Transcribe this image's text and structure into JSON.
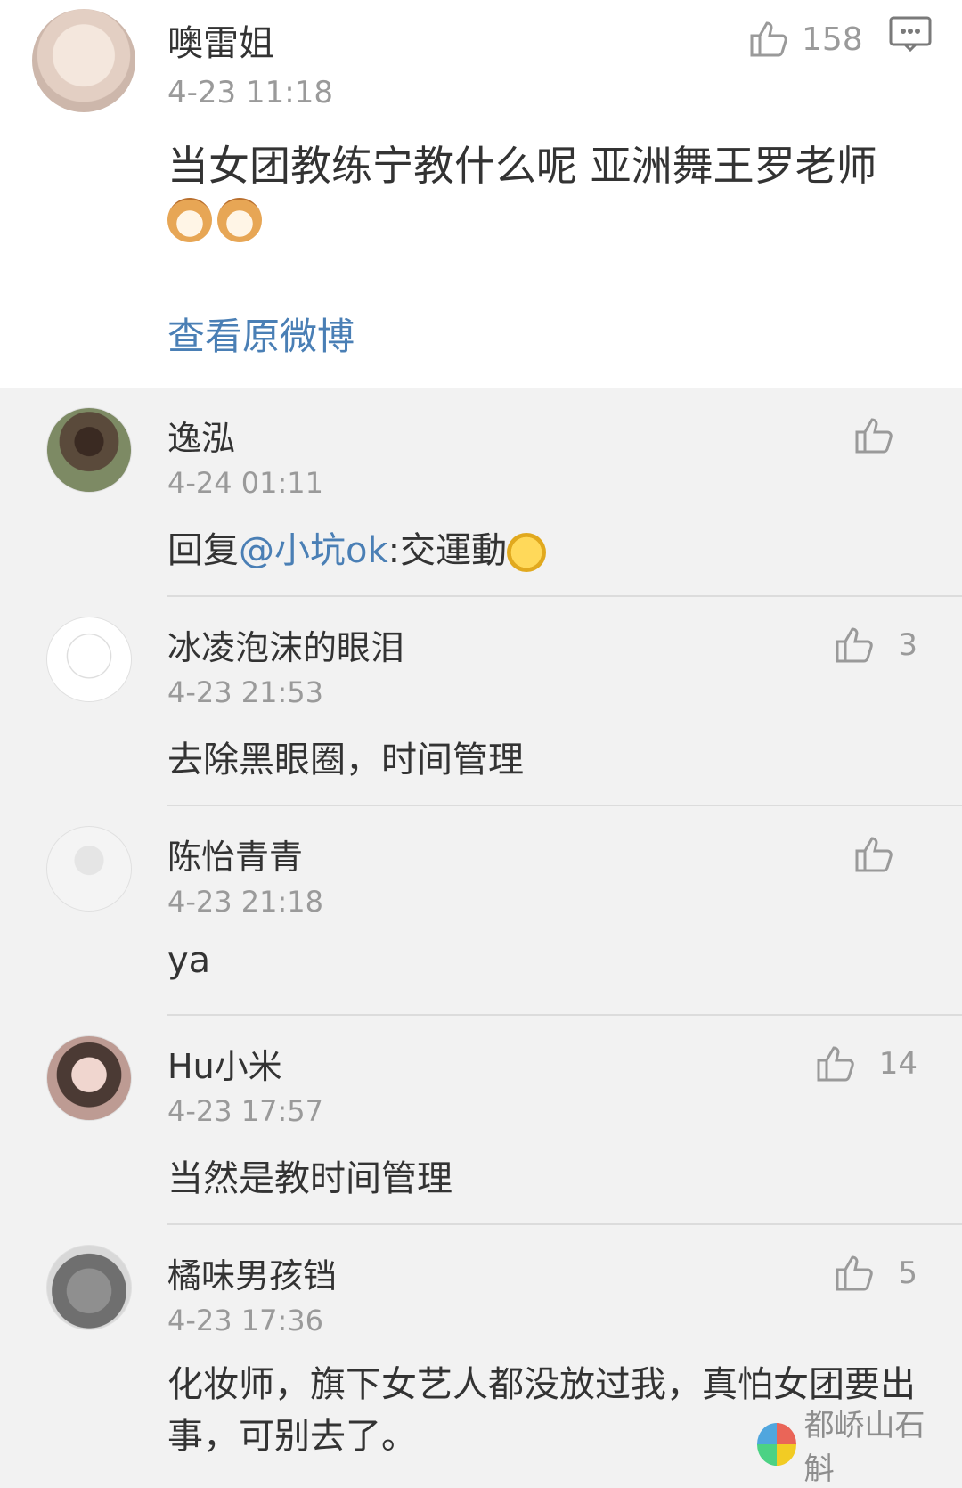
{
  "main": {
    "author": "噢雷姐",
    "time": "4-23 11:18",
    "likes": "158",
    "text": "当女团教练宁教什么呢 亚洲舞王罗老师",
    "view_original": "查看原微博"
  },
  "comments": [
    {
      "name": "逸泓",
      "time": "4-24 01:11",
      "likes": "",
      "reply_prefix": "回复",
      "mention": "@小坑ok",
      "reply_text": ":交運動"
    },
    {
      "name": "冰凌泡沫的眼泪",
      "time": "4-23 21:53",
      "likes": "3",
      "text": "去除黑眼圈，时间管理"
    },
    {
      "name": "陈怡青青",
      "time": "4-23 21:18",
      "likes": "",
      "text": "ya"
    },
    {
      "name": "Hu小米",
      "time": "4-23 17:57",
      "likes": "14",
      "text": "当然是教时间管理"
    },
    {
      "name": "橘味男孩铛",
      "time": "4-23 17:36",
      "likes": "5",
      "text": "化妆师，旗下女艺人都没放过我，真怕女团要出事，可别去了。"
    }
  ],
  "watermark": "都峤山石斛",
  "icons": {
    "like": "thumb-up-icon",
    "comment": "comment-icon",
    "cat_emoji": "cat-emoji-icon",
    "laugh_emoji": "laugh-cry-emoji-icon"
  },
  "colors": {
    "link": "#4a7fb5",
    "muted": "#9a9a9a",
    "panel": "#f2f2f2"
  }
}
